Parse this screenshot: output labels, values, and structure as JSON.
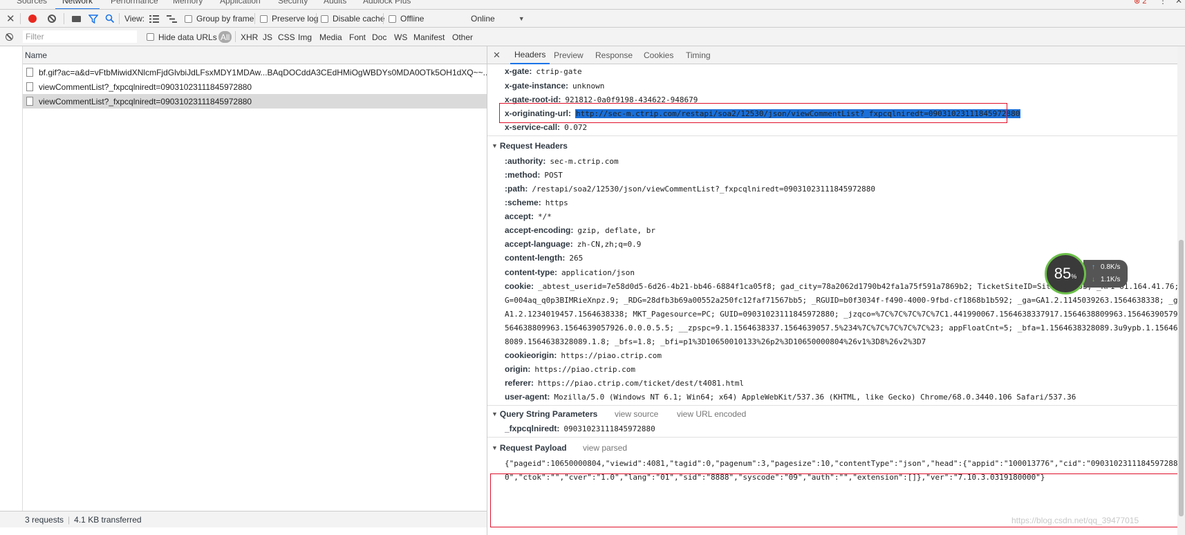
{
  "top_tabs": [
    "Sources",
    "Network",
    "Performance",
    "Memory",
    "Application",
    "Security",
    "Audits",
    "Adblock Plus"
  ],
  "top_error_count": "2",
  "toolbar": {
    "view_label": "View:",
    "group_by_frame": "Group by frame",
    "preserve_log": "Preserve log",
    "disable_cache": "Disable cache",
    "offline": "Offline",
    "throttle": "Online"
  },
  "filterbar": {
    "placeholder": "Filter",
    "hide_data_urls": "Hide data URLs",
    "types": [
      "All",
      "XHR",
      "JS",
      "CSS",
      "Img",
      "Media",
      "Font",
      "Doc",
      "WS",
      "Manifest",
      "Other"
    ]
  },
  "requests": {
    "header": "Name",
    "rows": [
      "bf.gif?ac=a&d=vFtbMiwidXNlcmFjdGlvbiJdLFsxMDY1MDAw...BAqDOCddA3CEdHMiOgWBDYs0MDA0OTk5OH1dXQ~~...",
      "viewCommentList?_fxpcqlniredt=09031023111845972880",
      "viewCommentList?_fxpcqlniredt=09031023111845972880"
    ],
    "status": "3 requests",
    "transferred": "4.1 KB transferred"
  },
  "detail_tabs": [
    "Headers",
    "Preview",
    "Response",
    "Cookies",
    "Timing"
  ],
  "response_headers": [
    {
      "k": "x-gate:",
      "v": "ctrip-gate"
    },
    {
      "k": "x-gate-instance:",
      "v": "unknown"
    },
    {
      "k": "x-gate-root-id:",
      "v": "921812-0a0f9198-434622-948679"
    },
    {
      "k": "x-originating-url:",
      "v": "http://sec-m.ctrip.com/restapi/soa2/12530/json/viewCommentList?_fxpcqlniredt=09031023111845972880"
    },
    {
      "k": "x-service-call:",
      "v": "0.072"
    }
  ],
  "request_headers_title": "Request Headers",
  "request_headers": [
    {
      "k": ":authority:",
      "v": "sec-m.ctrip.com"
    },
    {
      "k": ":method:",
      "v": "POST"
    },
    {
      "k": ":path:",
      "v": "/restapi/soa2/12530/json/viewCommentList?_fxpcqlniredt=09031023111845972880"
    },
    {
      "k": ":scheme:",
      "v": "https"
    },
    {
      "k": "accept:",
      "v": "*/*"
    },
    {
      "k": "accept-encoding:",
      "v": "gzip, deflate, br"
    },
    {
      "k": "accept-language:",
      "v": "zh-CN,zh;q=0.9"
    },
    {
      "k": "content-length:",
      "v": "265"
    },
    {
      "k": "content-type:",
      "v": "application/json"
    },
    {
      "k": "cookie:",
      "v": "_abtest_userid=7e58d0d5-6d26-4b21-bb46-6884f1ca05f8; gad_city=78a2062d1790b42fa1a75f591a7869b2; TicketSiteID=SiteID=1003; _RF1=61.164.41.76; _"
    }
  ],
  "cookie_continuation": [
    "G=004aq_q0p3BIMRieXnpz.9; _RDG=28dfb3b69a00552a250fc12faf71567bb5; _RGUID=b0f3034f-f490-4000-9fbd-cf1868b1b592; _ga=GA1.2.1145039263.1564638338; _gid=G",
    "A1.2.1234019457.1564638338; MKT_Pagesource=PC; GUID=09031023111845972880; _jzqco=%7C%7C%7C%7C%7C1.441990067.1564638337917.1564638809963.1564639057926",
    "564638809963.1564639057926.0.0.0.5.5; __zpspc=9.1.1564638337.1564639057.5%234%7C%7C%7C%7C%7C%23; appFloatCnt=5; _bfa=1.1564638328089.3u9ypb.1.1564638",
    "8089.1564638328089.1.8; _bfs=1.8; _bfi=p1%3D10650010133%26p2%3D10650000804%26v1%3D8%26v2%3D7"
  ],
  "request_headers_after": [
    {
      "k": "cookieorigin:",
      "v": "https://piao.ctrip.com"
    },
    {
      "k": "origin:",
      "v": "https://piao.ctrip.com"
    },
    {
      "k": "referer:",
      "v": "https://piao.ctrip.com/ticket/dest/t4081.html"
    },
    {
      "k": "user-agent:",
      "v": "Mozilla/5.0 (Windows NT 6.1; Win64; x64) AppleWebKit/537.36 (KHTML, like Gecko) Chrome/68.0.3440.106 Safari/537.36"
    }
  ],
  "query_params_title": "Query String Parameters",
  "query_view_source": "view source",
  "query_view_url_encoded": "view URL encoded",
  "query_param": {
    "k": "_fxpcqlniredt:",
    "v": "09031023111845972880"
  },
  "payload_title": "Request Payload",
  "payload_view_parsed": "view parsed",
  "payload_lines": [
    "{\"pageid\":10650000804,\"viewid\":4081,\"tagid\":0,\"pagenum\":3,\"pagesize\":10,\"contentType\":\"json\",\"head\":{\"appid\":\"100013776\",\"cid\":\"09031023111845972880\",",
    "0\",\"ctok\":\"\",\"cver\":\"1.0\",\"lang\":\"01\",\"sid\":\"8888\",\"syscode\":\"09\",\"auth\":\"\",\"extension\":[]},\"ver\":\"7.10.3.0319180000\"}"
  ],
  "speed_widget": {
    "percent": "85",
    "percent_unit": "%",
    "upload": "0.8K/s",
    "download": "1.1K/s"
  },
  "watermark": "https://blog.csdn.net/qq_39477015",
  "colors": {
    "record": "#e8281f",
    "accent": "#1a73e8",
    "highlight": "#e0102a"
  }
}
